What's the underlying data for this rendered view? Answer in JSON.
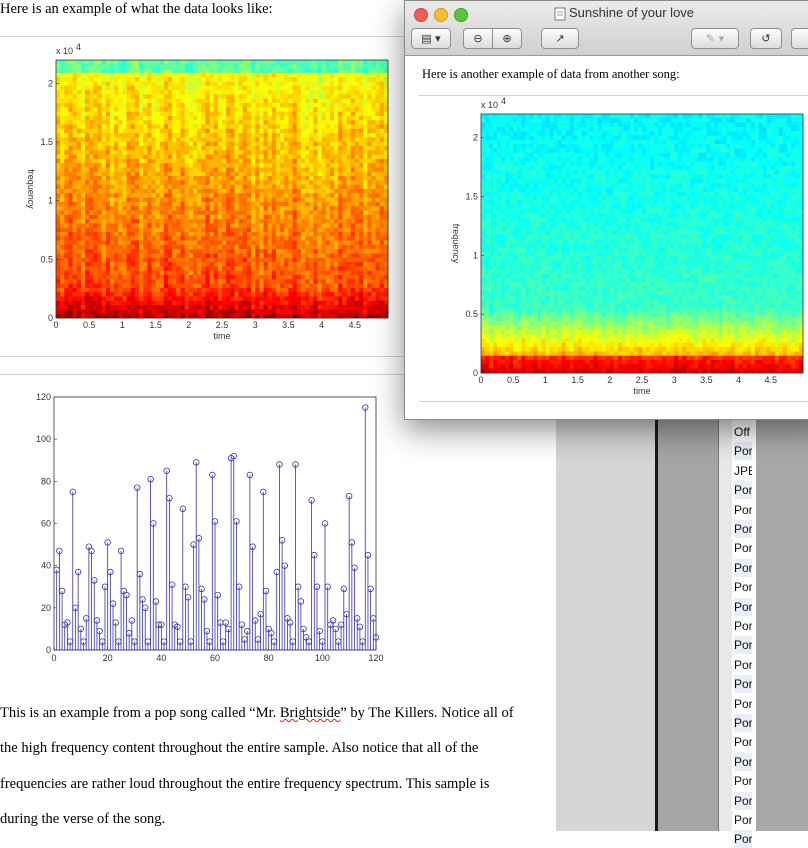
{
  "document": {
    "caption_top": "Here is an example of what the data looks like:",
    "paragraph": {
      "line1_pre": "This is an example from a pop song called “Mr. ",
      "line1_word": "Brightside",
      "line1_post": "” by The Killers. Notice all of",
      "line2": "the high frequency content throughout the entire sample. Also notice that all of the",
      "line3": "frequencies are rather loud throughout the entire frequency spectrum.  This sample is",
      "line4": "during the verse of the song."
    }
  },
  "window": {
    "title": "Sunshine of your love",
    "caption": "Here is another example of data from another song:",
    "toolbar": {
      "sidebar_btn": "▤ ▾",
      "zoom_out": "⊖",
      "zoom_in": "⊕",
      "share": "↗",
      "annotate": "✎ ▾",
      "rotate": "↺"
    }
  },
  "sidebar_list": [
    "Off",
    "Por",
    "JPE",
    "Por",
    "Por",
    "Por",
    "Por",
    "Por",
    "Por",
    "Por",
    "Por",
    "Por",
    "Por",
    "Por",
    "Por",
    "Por",
    "Por",
    "Por",
    "Por",
    "Por",
    "Por",
    "Por"
  ],
  "chart_data": [
    {
      "type": "heatmap",
      "title": "",
      "xlabel": "time",
      "ylabel": "frequency",
      "y_multiplier_label": "x 10",
      "y_multiplier_exp": "4",
      "xlim": [
        0,
        5
      ],
      "ylim": [
        0,
        2.2
      ],
      "x_ticks": [
        "0",
        "0.5",
        "1",
        "1.5",
        "2",
        "2.5",
        "3",
        "3.5",
        "4",
        "4.5"
      ],
      "y_ticks": [
        "0",
        "0.5",
        "1",
        "1.5",
        "2"
      ],
      "colormap": "jet (red = high energy, cyan = low)"
    },
    {
      "type": "heatmap",
      "title": "",
      "xlabel": "time",
      "ylabel": "frequency",
      "y_multiplier_label": "x 10",
      "y_multiplier_exp": "4",
      "xlim": [
        0,
        5
      ],
      "ylim": [
        0,
        2.2
      ],
      "x_ticks": [
        "0",
        "0.5",
        "1",
        "1.5",
        "2",
        "2.5",
        "3",
        "3.5",
        "4",
        "4.5"
      ],
      "y_ticks": [
        "0",
        "0.5",
        "1",
        "1.5",
        "2"
      ],
      "colormap": "jet (red = high energy, cyan = low)"
    },
    {
      "type": "scatter",
      "style": "stem",
      "color": "#3333aa",
      "xlim": [
        0,
        120
      ],
      "ylim": [
        0,
        120
      ],
      "x_ticks": [
        "0",
        "20",
        "40",
        "60",
        "80",
        "100",
        "120"
      ],
      "y_ticks": [
        "0",
        "20",
        "40",
        "60",
        "80",
        "100",
        "120"
      ],
      "x": [
        1,
        2,
        3,
        4,
        5,
        6,
        7,
        8,
        9,
        10,
        11,
        12,
        13,
        14,
        15,
        16,
        17,
        18,
        19,
        20,
        21,
        22,
        23,
        24,
        25,
        26,
        27,
        28,
        29,
        30,
        31,
        32,
        33,
        34,
        35,
        36,
        37,
        38,
        39,
        40,
        41,
        42,
        43,
        44,
        45,
        46,
        47,
        48,
        49,
        50,
        51,
        52,
        53,
        54,
        55,
        56,
        57,
        58,
        59,
        60,
        61,
        62,
        63,
        64,
        65,
        66,
        67,
        68,
        69,
        70,
        71,
        72,
        73,
        74,
        75,
        76,
        77,
        78,
        79,
        80,
        81,
        82,
        83,
        84,
        85,
        86,
        87,
        88,
        89,
        90,
        91,
        92,
        93,
        94,
        95,
        96,
        97,
        98,
        99,
        100,
        101,
        102,
        103,
        104,
        105,
        106,
        107,
        108,
        109,
        110,
        111,
        112,
        113,
        114,
        115,
        116,
        117,
        118,
        119,
        120
      ],
      "y": [
        38,
        47,
        28,
        12,
        13,
        4,
        75,
        20,
        37,
        10,
        4,
        15,
        49,
        47,
        33,
        14,
        9,
        4,
        30,
        51,
        37,
        22,
        13,
        4,
        47,
        28,
        26,
        8,
        14,
        4,
        77,
        36,
        24,
        20,
        4,
        81,
        60,
        23,
        12,
        12,
        4,
        85,
        72,
        31,
        12,
        11,
        4,
        67,
        30,
        25,
        4,
        50,
        89,
        53,
        29,
        24,
        9,
        4,
        83,
        61,
        26,
        13,
        4,
        13,
        10,
        91,
        92,
        61,
        30,
        12,
        5,
        9,
        83,
        49,
        14,
        5,
        17,
        75,
        28,
        10,
        8,
        4,
        37,
        88,
        52,
        40,
        15,
        13,
        4,
        88,
        30,
        23,
        10,
        6,
        4,
        71,
        45,
        30,
        9,
        4,
        60,
        30,
        12,
        14,
        10,
        4,
        12,
        29,
        17,
        73,
        51,
        39,
        15,
        11,
        4,
        115,
        45,
        29,
        15,
        6
      ]
    }
  ]
}
